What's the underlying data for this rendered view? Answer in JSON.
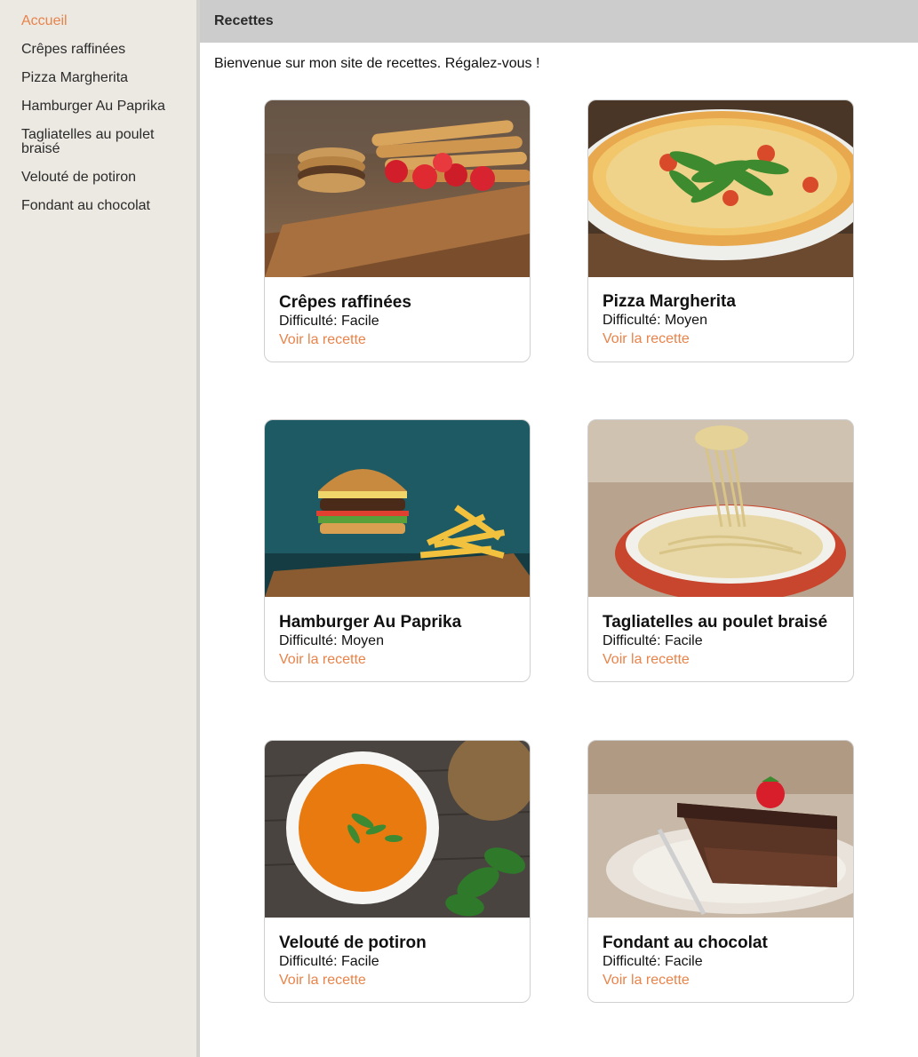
{
  "sidebar": {
    "items": [
      {
        "label": "Accueil"
      },
      {
        "label": "Crêpes raffinées"
      },
      {
        "label": "Pizza Margherita"
      },
      {
        "label": "Hamburger Au Paprika"
      },
      {
        "label": "Tagliatelles au poulet braisé"
      },
      {
        "label": "Velouté de potiron"
      },
      {
        "label": "Fondant au chocolat"
      }
    ]
  },
  "header": {
    "title": "Recettes"
  },
  "main": {
    "welcome": "Bienvenue sur mon site de recettes. Régalez-vous !",
    "cards": [
      {
        "title": "Crêpes raffinées",
        "difficulty": "Difficulté: Facile",
        "link": "Voir la recette"
      },
      {
        "title": "Pizza Margherita",
        "difficulty": "Difficulté: Moyen",
        "link": "Voir la recette"
      },
      {
        "title": "Hamburger Au Paprika",
        "difficulty": "Difficulté: Moyen",
        "link": "Voir la recette"
      },
      {
        "title": "Tagliatelles au poulet braisé",
        "difficulty": "Difficulté: Facile",
        "link": "Voir la recette"
      },
      {
        "title": "Velouté de potiron",
        "difficulty": "Difficulté: Facile",
        "link": "Voir la recette"
      },
      {
        "title": "Fondant au chocolat",
        "difficulty": "Difficulté: Facile",
        "link": "Voir la recette"
      }
    ]
  },
  "colors": {
    "accent": "#e8834a",
    "sidebar_bg": "#ece8e2",
    "header_bg": "#cccccc"
  }
}
